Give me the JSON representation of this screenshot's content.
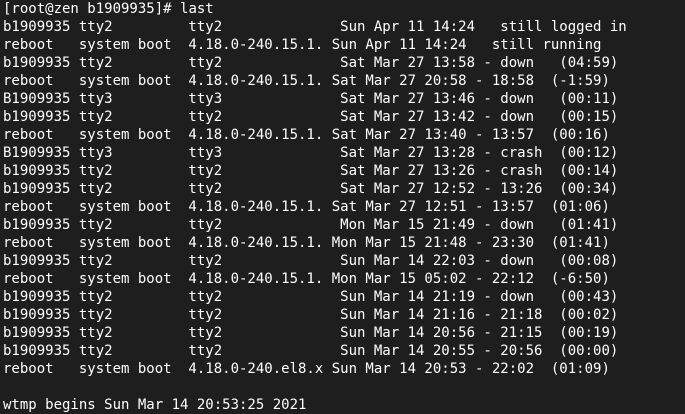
{
  "prompt": "[root@zen b1909935]# ",
  "command": "last",
  "rows": [
    "b1909935 tty2         tty2              Sun Apr 11 14:24   still logged in",
    "reboot   system boot  4.18.0-240.15.1. Sun Apr 11 14:24   still running",
    "b1909935 tty2         tty2              Sat Mar 27 13:58 - down   (04:59)",
    "reboot   system boot  4.18.0-240.15.1. Sat Mar 27 20:58 - 18:58  (-1:59)",
    "B1909935 tty3         tty3              Sat Mar 27 13:46 - down   (00:11)",
    "b1909935 tty2         tty2              Sat Mar 27 13:42 - down   (00:15)",
    "reboot   system boot  4.18.0-240.15.1. Sat Mar 27 13:40 - 13:57  (00:16)",
    "B1909935 tty3         tty3              Sat Mar 27 13:28 - crash  (00:12)",
    "b1909935 tty2         tty2              Sat Mar 27 13:26 - crash  (00:14)",
    "b1909935 tty2         tty2              Sat Mar 27 12:52 - 13:26  (00:34)",
    "reboot   system boot  4.18.0-240.15.1. Sat Mar 27 12:51 - 13:57  (01:06)",
    "b1909935 tty2         tty2              Mon Mar 15 21:49 - down   (01:41)",
    "reboot   system boot  4.18.0-240.15.1. Mon Mar 15 21:48 - 23:30  (01:41)",
    "b1909935 tty2         tty2              Sun Mar 14 22:03 - down   (00:08)",
    "reboot   system boot  4.18.0-240.15.1. Mon Mar 15 05:02 - 22:12  (-6:50)",
    "b1909935 tty2         tty2              Sun Mar 14 21:19 - down   (00:43)",
    "b1909935 tty2         tty2              Sun Mar 14 21:16 - 21:18  (00:02)",
    "b1909935 tty2         tty2              Sun Mar 14 20:56 - 21:15  (00:19)",
    "b1909935 tty2         tty2              Sun Mar 14 20:55 - 20:56  (00:00)",
    "reboot   system boot  4.18.0-240.el8.x Sun Mar 14 20:53 - 22:02  (01:09)"
  ],
  "blank": "",
  "footer": "wtmp begins Sun Mar 14 20:53:25 2021",
  "colors": {
    "background": "#1e1e1e",
    "foreground": "#ffffff"
  }
}
